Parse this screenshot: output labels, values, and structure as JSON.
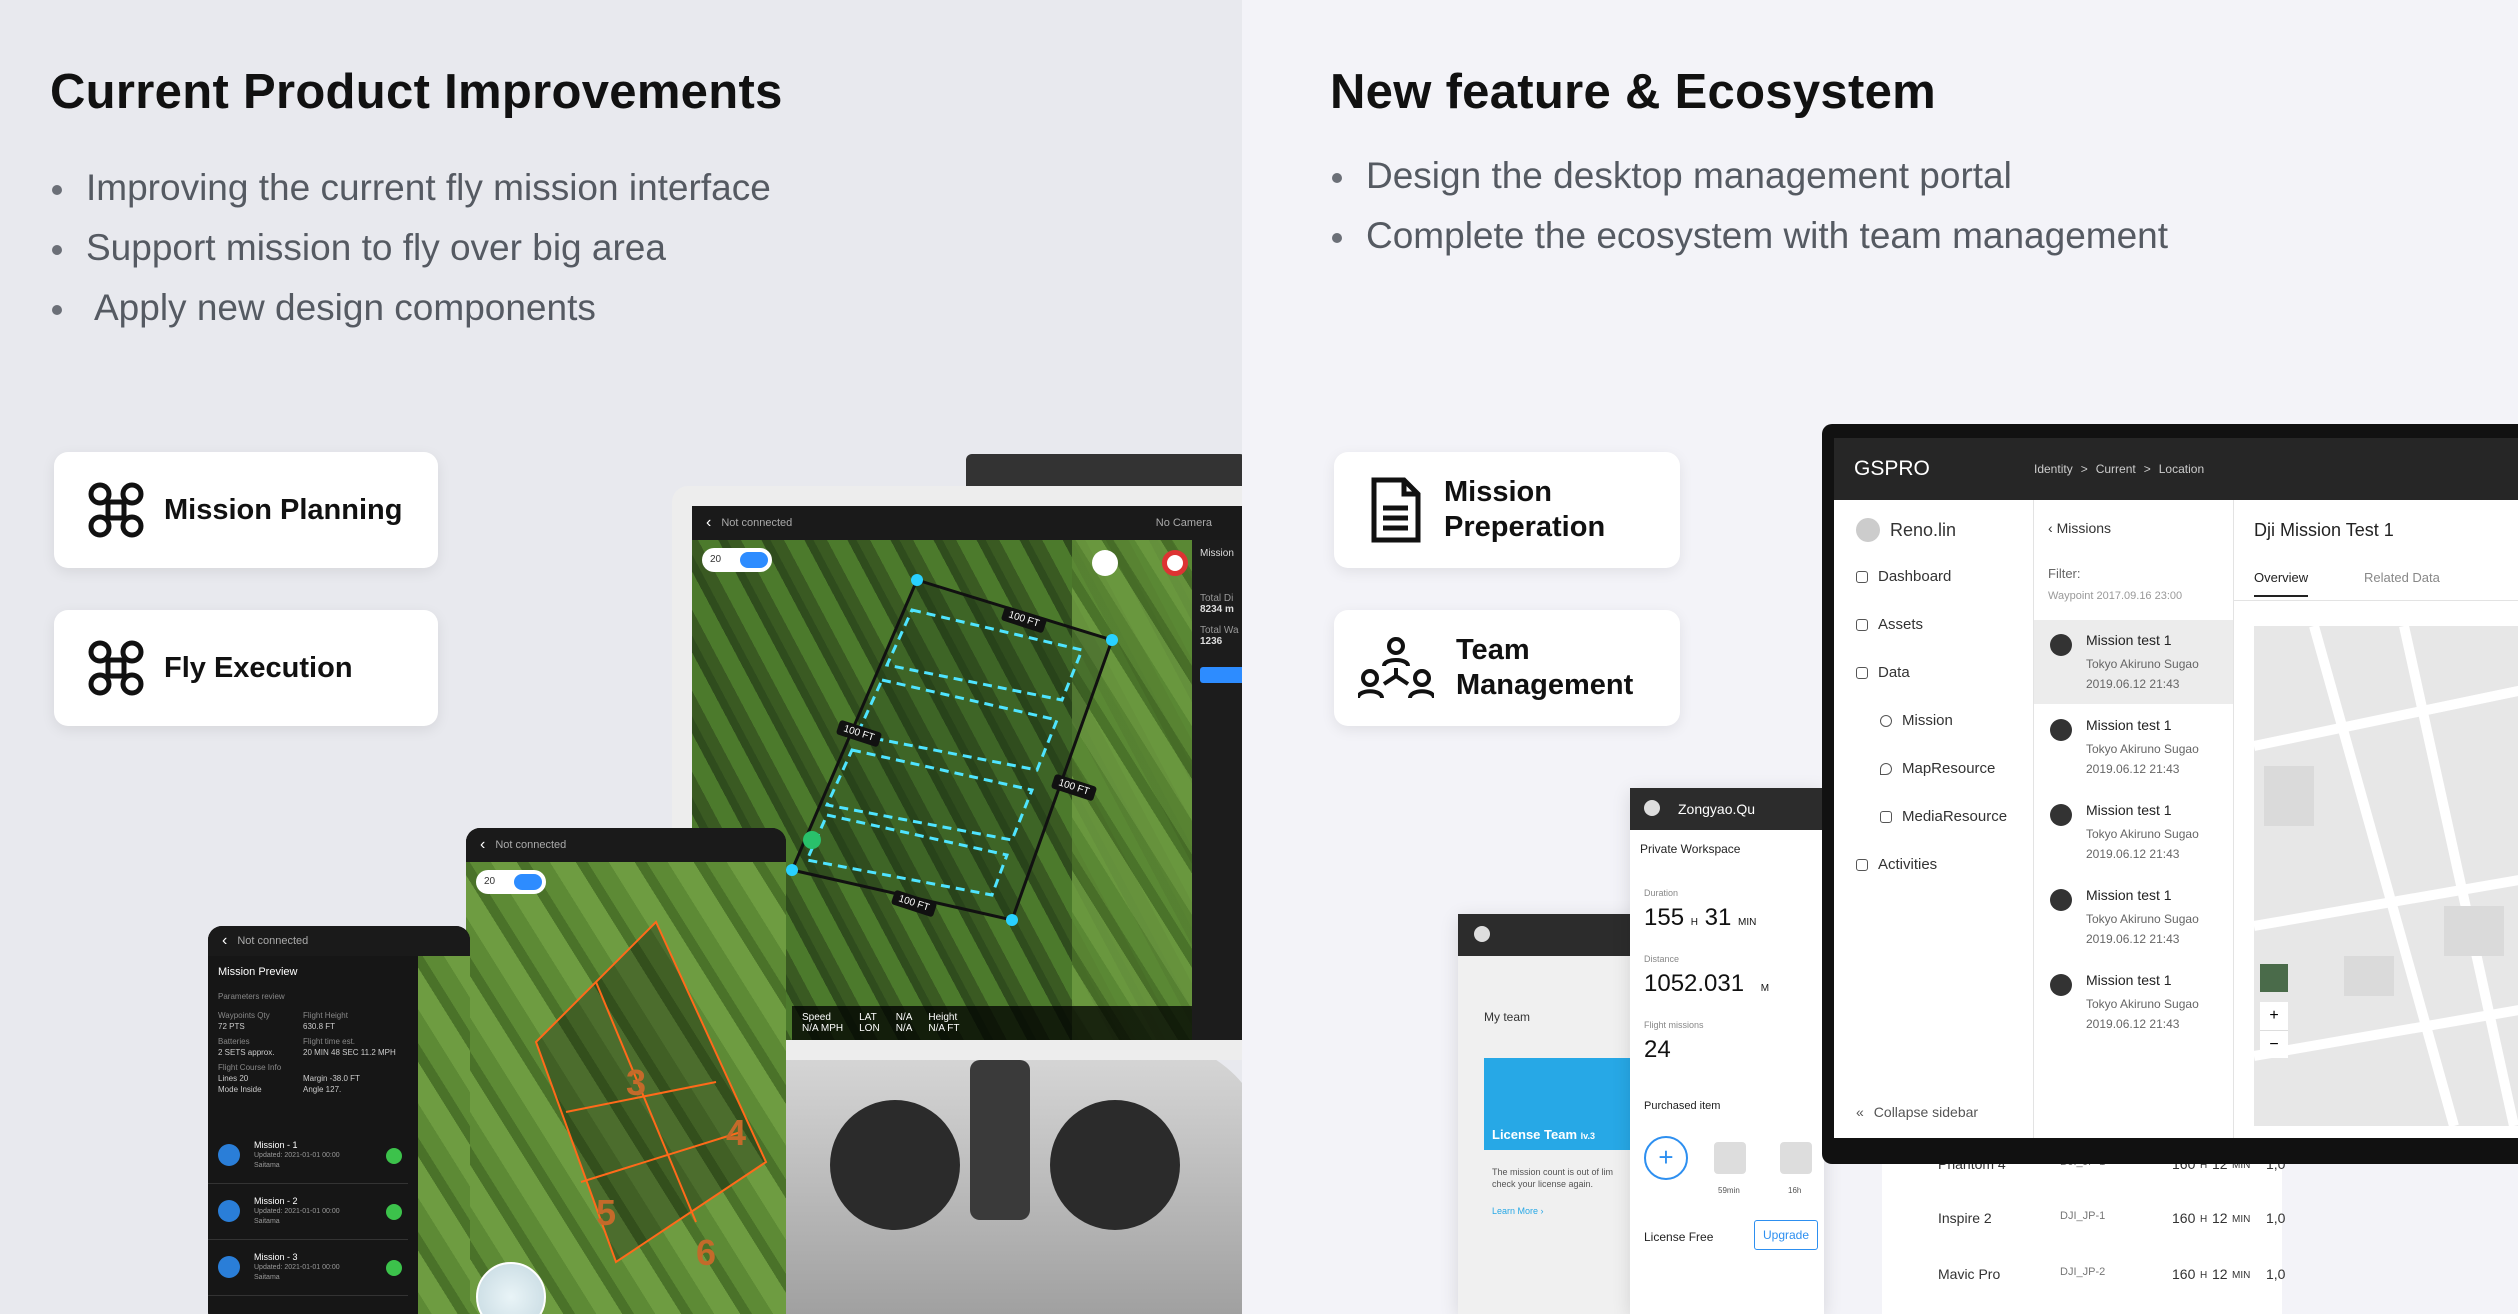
{
  "left": {
    "title": "Current Product Improvements",
    "bullets": [
      "Improving the current fly mission interface",
      "Support mission to fly over big area",
      "Apply new design components"
    ],
    "cards": [
      {
        "label": "Mission Planning",
        "icon": "drone-icon"
      },
      {
        "label": "Fly Execution",
        "icon": "drone-icon"
      }
    ],
    "tablet": {
      "status": "Not connected",
      "no_camera": "No Camera",
      "panel_label": "Mission",
      "total_dist_label": "Total Di",
      "total_dist_value": "8234 m",
      "total_way_label": "Total Wa",
      "total_way_value": "1236",
      "segment_labels": [
        "100 FT",
        "100 FT",
        "100 FT",
        "100 FT"
      ],
      "speed_label": "Speed",
      "speed_value": "N/A MPH",
      "lat": "LAT",
      "lon": "LON",
      "na": "N/A",
      "height_label": "Height",
      "height_value": "N/A FT",
      "toggle_value": "20"
    },
    "tablet2": {
      "status": "Not connected",
      "toggle_value": "20",
      "area_numbers": [
        "3",
        "4",
        "5",
        "6"
      ]
    },
    "phone": {
      "status": "Not connected",
      "title": "Mission Preview",
      "params_label": "Parameters review",
      "waypoints_label": "Waypoints Qty",
      "waypoints_value": "72 PTS",
      "flight_height_label": "Flight Height",
      "flight_height_value": "630.8 FT",
      "batteries_label": "Batteries",
      "batteries_value": "2 SETS approx.",
      "flight_time_label": "Flight time est.",
      "flight_time_value": "20 MIN 48 SEC 11.2 MPH",
      "course_label": "Flight Course Info",
      "lines": "Lines    20",
      "mode": "Mode   Inside",
      "margin": "Margin  -38.0 FT",
      "angle": "Angle   127.",
      "missions": [
        {
          "name": "Mission - 1",
          "updated": "Updated: 2021-01-01 00:00",
          "place": "Saitama"
        },
        {
          "name": "Mission - 2",
          "updated": "Updated: 2021-01-01 00:00",
          "place": "Saitama"
        },
        {
          "name": "Mission - 3",
          "updated": "Updated: 2021-01-01 00:00",
          "place": "Saitama"
        }
      ]
    }
  },
  "right": {
    "title": "New feature & Ecosystem",
    "bullets": [
      "Design the desktop management portal",
      "Complete the ecosystem with team management"
    ],
    "cards": [
      {
        "label_line1": "Mission",
        "label_line2": "Preperation",
        "icon": "document-icon"
      },
      {
        "label_line1": "Team",
        "label_line2": "Management",
        "icon": "team-icon"
      }
    ],
    "portal": {
      "brand": "GS",
      "brand_suffix": "PRO",
      "breadcrumb": [
        "Identity",
        ">",
        "Current",
        ">",
        "Location"
      ],
      "user": "Reno.lin",
      "nav": [
        "Dashboard",
        "Assets",
        "Data",
        "Mission",
        "MapResource",
        "MediaResource",
        "Activities"
      ],
      "collapse": "Collapse sidebar",
      "list_back": "Missions",
      "filter_label": "Filter:",
      "filter_value": "Waypoint 2017.09.16 23:00",
      "missions": [
        {
          "title": "Mission test 1",
          "sub": "Tokyo Akiruno Sugao",
          "date": "2019.06.12 21:43"
        },
        {
          "title": "Mission test 1",
          "sub": "Tokyo Akiruno Sugao",
          "date": "2019.06.12 21:43"
        },
        {
          "title": "Mission test 1",
          "sub": "Tokyo Akiruno Sugao",
          "date": "2019.06.12 21:43"
        },
        {
          "title": "Mission test 1",
          "sub": "Tokyo Akiruno Sugao",
          "date": "2019.06.12 21:43"
        },
        {
          "title": "Mission test 1",
          "sub": "Tokyo Akiruno Sugao",
          "date": "2019.06.12 21:43"
        }
      ],
      "detail_title": "Dji Mission Test 1",
      "tabs": [
        "Overview",
        "Related Data"
      ],
      "zoom_in": "+",
      "zoom_out": "−"
    },
    "workspace": {
      "user": "Zongyao.Qu",
      "label": "Private Workspace",
      "duration_label": "Duration",
      "duration_h": "155",
      "duration_m": "31",
      "h_unit": "H",
      "min_unit": "MIN",
      "distance_label": "Distance",
      "distance_value": "1052.031",
      "distance_unit": "M",
      "flights_label": "Flight missions",
      "flights_value": "24",
      "purchased_label": "Purchased item",
      "item1": "59min",
      "item2": "16h",
      "license_label": "License Free",
      "upgrade": "Upgrade"
    },
    "team_phone": {
      "my_team": "My team",
      "license_team": "License Team",
      "license_level": "lv.3",
      "notice": "The mission count is out of lim check your license again.",
      "learn_more": "Learn More ›"
    },
    "drones": [
      {
        "name": "Phantom 4",
        "id": "DJI_JP-1",
        "time": "160",
        "h": "H",
        "min": "12",
        "unit": "MIN",
        "extra": "1,0"
      },
      {
        "name": "Inspire 2",
        "id": "DJI_JP-1",
        "time": "160",
        "h": "H",
        "min": "12",
        "unit": "MIN",
        "extra": "1,0"
      },
      {
        "name": "Mavic Pro",
        "id": "DJI_JP-2",
        "time": "160",
        "h": "H",
        "min": "12",
        "unit": "MIN",
        "extra": "1,0"
      }
    ]
  }
}
